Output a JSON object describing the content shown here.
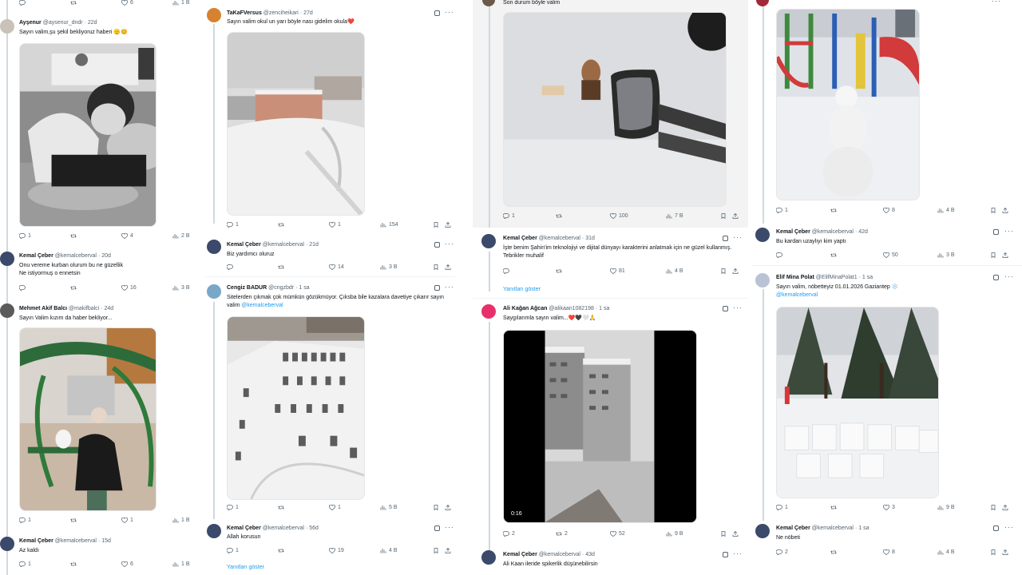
{
  "col1": {
    "top_actions": [
      "",
      "",
      "6",
      "1 B"
    ],
    "tweet_aysenur": {
      "name": "Ayşenur",
      "handle": "@aysenur_dndr",
      "time": "· 22d",
      "text": "Sayın valim,şu şekil bekliyoruz haberi 🫡😊",
      "actions": [
        "1",
        "",
        "4",
        "2 B"
      ]
    },
    "tweet_kemal_1": {
      "name": "Kemal Çeber",
      "handle": "@kemalceberval",
      "time": "· 20d",
      "text": "Onu vereme kurban olurum bu ne güzellik\nNe istiyormuş o ennetsin",
      "actions": [
        "",
        "",
        "16",
        "3 B"
      ]
    },
    "tweet_mehmet": {
      "name": "Mehmet Akif Balcı",
      "handle": "@makifbalci",
      "time": "· 24d",
      "text": "Sayın Valim kızım da haber bekliyor...",
      "actions": [
        "1",
        "",
        "1",
        "1 B"
      ]
    },
    "tweet_kemal_2": {
      "name": "Kemal Çeber",
      "handle": "@kemalceberval",
      "time": "· 15d",
      "text": "Az kaldı",
      "actions": [
        "1",
        "",
        "6",
        "1 B"
      ]
    }
  },
  "col2": {
    "tweet_takaf": {
      "name": "TaKaFVersus",
      "handle": "@zenciheikari",
      "time": "· 27d",
      "text": "Sayın valim okul un yarı böyle nası gidelim okula❤️",
      "actions": [
        "1",
        "",
        "1",
        "154"
      ]
    },
    "tweet_kemal_3": {
      "name": "Kemal Çeber",
      "handle": "@kemalceberval",
      "time": "· 21d",
      "text": "Biz yardımcı oluruz",
      "actions": [
        "",
        "",
        "14",
        "3 B"
      ]
    },
    "tweet_cengiz": {
      "name": "Cengiz BADUR",
      "handle": "@cngzbdr",
      "time": "· 1 sa",
      "text": "Sitelerden çıkmak çok mümkün gözükmüyor. Çıksba bile kazalara davetiye çıkarır sayın valim",
      "mention": "@kemalceberval",
      "actions": [
        "1",
        "",
        "1",
        "5 B"
      ]
    },
    "tweet_kemal_4": {
      "name": "Kemal Çeber",
      "handle": "@kemalceberval",
      "time": "· 56d",
      "text": "Allah korusun",
      "actions": [
        "1",
        "",
        "19",
        "4 B"
      ]
    },
    "show_replies": "Yanıtları göster"
  },
  "col3": {
    "tweet_top": {
      "text": "Son durum böyle valim",
      "actions": [
        "1",
        "",
        "100",
        "7 B"
      ]
    },
    "tweet_kemal_5": {
      "name": "Kemal Çeber",
      "handle": "@kemalceberval",
      "time": "· 31d",
      "text": "İşte benim Şahin'im teknolojiyi ve dijital dünyayı karakterini anlatmak için ne güzel kullanmış. Tebrikler muhalif",
      "actions": [
        "",
        "",
        "81",
        "4 B"
      ]
    },
    "show_replies": "Yanıtları göster",
    "tweet_ali": {
      "name": "Ali Kağan Ağcan",
      "handle": "@alikaan1082198",
      "time": "· 1 sa",
      "text": "Saygılarımla sayın valim...❤️🖤🤍🙏",
      "video_duration": "0:16",
      "actions": [
        "2",
        "2",
        "52",
        "9 B"
      ]
    },
    "tweet_kemal_6": {
      "name": "Kemal Çeber",
      "handle": "@kemalceberval",
      "time": "· 43d",
      "text": "Ali Kaan ileride spikerlik düşünebilirsin"
    }
  },
  "col4": {
    "tweet_top": {
      "actions": [
        "1",
        "",
        "8",
        "4 B"
      ]
    },
    "tweet_kemal_7": {
      "name": "Kemal Çeber",
      "handle": "@kemalceberval",
      "time": "· 42d",
      "text": "Bu kardan uzaylıyı kim yaptı",
      "actions": [
        "",
        "",
        "50",
        "3 B"
      ]
    },
    "tweet_elif": {
      "name": "Elif Mina Polat",
      "handle": "@ElifMinaPolat1",
      "time": "· 1 sa",
      "text": "Sayın valim, nöbetteyiz 01.01.2026 Gaziantep ❄️",
      "mention": "@kemalceberval",
      "actions": [
        "1",
        "",
        "3",
        "9 B"
      ]
    },
    "tweet_kemal_8": {
      "name": "Kemal Çeber",
      "handle": "@kemalceberval",
      "time": "· 1 sa",
      "text": "Ne nöbeti",
      "actions": [
        "2",
        "",
        "8",
        "4 B"
      ]
    }
  }
}
